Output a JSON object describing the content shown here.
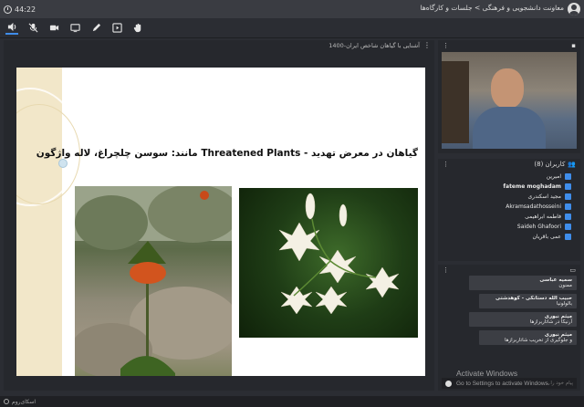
{
  "topbar": {
    "time": "44:22",
    "title": "معاونت دانشجویی و فرهنگی > جلسات و کارگاه‌ها"
  },
  "toolbar": {
    "items": [
      {
        "icon": "speaker-icon",
        "active": true
      },
      {
        "icon": "mic-off-icon",
        "active": false
      },
      {
        "icon": "camera-icon",
        "active": false
      },
      {
        "icon": "screen-share-icon",
        "active": false
      },
      {
        "icon": "pen-icon",
        "active": false
      },
      {
        "icon": "play-icon",
        "active": false
      },
      {
        "icon": "hand-icon",
        "active": false
      }
    ]
  },
  "presentation": {
    "file_name": "1400-آشنایی با گیاهان شاخص ایران",
    "slide_title": "گیاهان در معرض تهدید - Threatened Plants مانند: سوسن چلچراغ، لاله واژگون"
  },
  "users": {
    "header": "کاربران (8)",
    "list": [
      {
        "name": "امیرین",
        "bold": false
      },
      {
        "name": "fateme moghadam",
        "bold": true
      },
      {
        "name": "مجید اسکندری",
        "bold": false
      },
      {
        "name": "Akramsadathosseini",
        "bold": false
      },
      {
        "name": "فاطمه ابراهیمی",
        "bold": false
      },
      {
        "name": "Saideh Ghafoori",
        "bold": false
      },
      {
        "name": "عمی باقریان",
        "bold": false
      }
    ]
  },
  "chat": {
    "messages": [
      {
        "name": "سمیه عباسی",
        "text": "ممنون"
      },
      {
        "name": "حبیب الله دستانکی - کوهدشتی",
        "text": "بالولونیا"
      },
      {
        "name": "میثم نبوری",
        "text": "آرنیکا در شاتاربرازها"
      },
      {
        "name": "میثم نبوری",
        "text": "و جلوگیری از تخریب شاتاربرازها"
      }
    ],
    "input_placeholder": "پیام خود را..."
  },
  "watermark": {
    "line1": "Activate Windows",
    "line2": "Go to Settings to activate Windows."
  },
  "footer": {
    "brand": "اسکای‌روم"
  }
}
